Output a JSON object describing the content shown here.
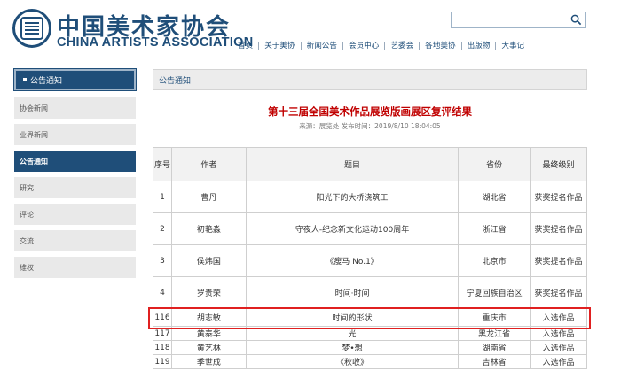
{
  "header": {
    "logo_cn": "中国美术家协会",
    "logo_en": "CHINA ARTISTS ASSOCIATION",
    "search_placeholder": ""
  },
  "nav": [
    "首页",
    "关于美协",
    "新闻公告",
    "会员中心",
    "艺委会",
    "各地美协",
    "出版物",
    "大事记"
  ],
  "sidebar": {
    "title": "公告通知",
    "items": [
      {
        "label": "协会新闻",
        "active": false
      },
      {
        "label": "业界新闻",
        "active": false
      },
      {
        "label": "公告通知",
        "active": true
      },
      {
        "label": "研究",
        "active": false
      },
      {
        "label": "评论",
        "active": false
      },
      {
        "label": "交流",
        "active": false
      },
      {
        "label": "维权",
        "active": false
      }
    ]
  },
  "content": {
    "section_title": "公告通知",
    "article_title": "第十三届全国美术作品展览版画展区复评结果",
    "article_meta": "来源：展览处 发布时间：2019/8/10 18:04:05"
  },
  "table": {
    "headers": [
      "序号",
      "作者",
      "题目",
      "省份",
      "最终级别"
    ],
    "rows": [
      {
        "no": "1",
        "author": "曹丹",
        "title": "阳光下的大桥浇筑工",
        "province": "湖北省",
        "level": "获奖提名作品",
        "size": "tall"
      },
      {
        "no": "2",
        "author": "初艳淼",
        "title": "守夜人-纪念新文化运动100周年",
        "province": "浙江省",
        "level": "获奖提名作品",
        "size": "tall"
      },
      {
        "no": "3",
        "author": "侯炜国",
        "title": "《瘦马 No.1》",
        "province": "北京市",
        "level": "获奖提名作品",
        "size": "tall"
      },
      {
        "no": "4",
        "author": "罗贵荣",
        "title": "时间·时间",
        "province": "宁夏回族自治区",
        "level": "获奖提名作品",
        "size": "tall"
      },
      {
        "no": "116",
        "author": "胡志敏",
        "title": "时间的形状",
        "province": "重庆市",
        "level": "入选作品",
        "size": "highlight"
      },
      {
        "no": "117",
        "author": "黄泰华",
        "title": "光",
        "province": "黑龙江省",
        "level": "入选作品",
        "size": "short"
      },
      {
        "no": "118",
        "author": "黄艺林",
        "title": "梦•想",
        "province": "湖南省",
        "level": "入选作品",
        "size": "short"
      },
      {
        "no": "119",
        "author": "季世成",
        "title": "《秋收》",
        "province": "吉林省",
        "level": "入选作品",
        "size": "short"
      }
    ]
  }
}
